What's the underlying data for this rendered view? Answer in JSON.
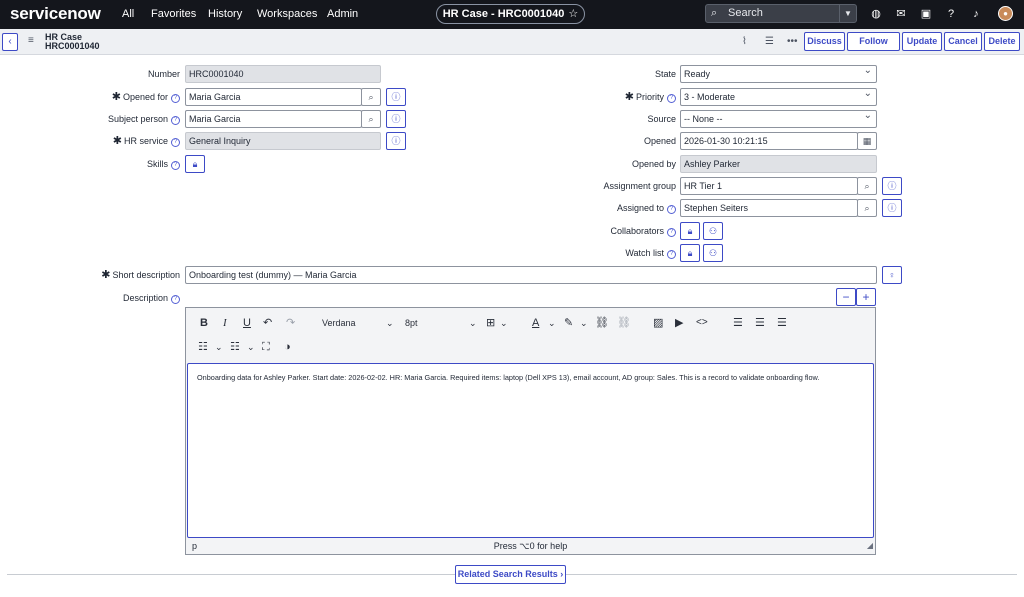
{
  "topnav": {
    "logo": "servicenow",
    "links": [
      "All",
      "Favorites",
      "History",
      "Workspaces",
      "Admin"
    ],
    "context_title": "HR Case - HRC0001040",
    "search_placeholder": "Search",
    "icons": [
      "globe-icon",
      "chat-icon",
      "scratchpad-icon",
      "help-icon",
      "bell-icon",
      "avatar"
    ]
  },
  "header": {
    "title_line1": "HR Case",
    "title_line2": "HRC0001040",
    "buttons": [
      "Discuss",
      "Follow",
      "Update",
      "Cancel",
      "Delete"
    ]
  },
  "left_fields": {
    "number": {
      "label": "Number",
      "value": "HRC0001040"
    },
    "opened_for": {
      "label": "Opened for",
      "value": "Maria Garcia"
    },
    "subject_person": {
      "label": "Subject person",
      "value": "Maria Garcia"
    },
    "hr_service": {
      "label": "HR service",
      "value": "General Inquiry"
    },
    "skills": {
      "label": "Skills"
    }
  },
  "right_fields": {
    "state": {
      "label": "State",
      "value": "Ready"
    },
    "priority": {
      "label": "Priority",
      "value": "3 - Moderate"
    },
    "source": {
      "label": "Source",
      "value": "-- None --"
    },
    "opened": {
      "label": "Opened",
      "value": "2026-01-30 10:21:15"
    },
    "opened_by": {
      "label": "Opened by",
      "value": "Ashley Parker"
    },
    "assignment_group": {
      "label": "Assignment group",
      "value": "HR Tier 1"
    },
    "assigned_to": {
      "label": "Assigned to",
      "value": "Stephen Seiters"
    },
    "collaborators": {
      "label": "Collaborators"
    },
    "watch_list": {
      "label": "Watch list"
    }
  },
  "short_description": {
    "label": "Short description",
    "value": "Onboarding test (dummy) — Maria Garcia"
  },
  "description": {
    "label": "Description",
    "font": "Verdana",
    "size": "8pt",
    "body": "Onboarding data for Ashley Parker. Start date: 2026-02-02. HR: Maria Garcia. Required items: laptop (Dell XPS 13), email account, AD group: Sales. This is a record to validate onboarding flow.",
    "status_path": "p",
    "status_help": "Press ⌥0 for help"
  },
  "related_search": "Related Search Results"
}
